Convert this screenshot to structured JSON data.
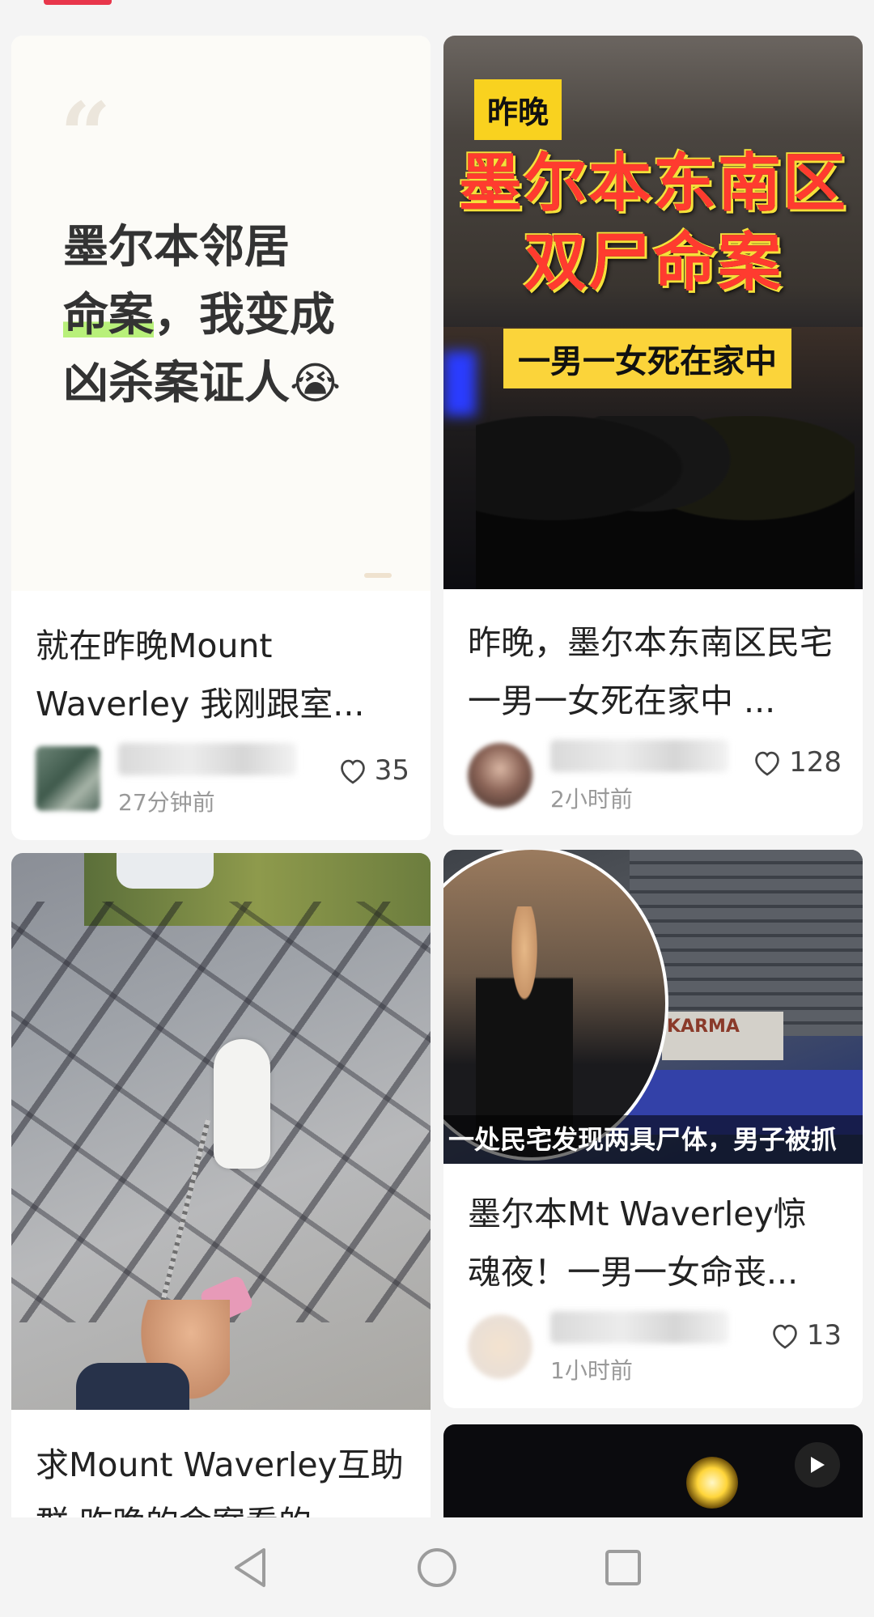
{
  "feed": {
    "cards": [
      {
        "cover_text_lines": [
          "墨尔本邻居",
          "命案",
          "，我变成",
          "凶杀案证人"
        ],
        "cover_emoji": "😭",
        "title": "就在昨晚Mount Waverley 我刚跟室...",
        "author": "Hacitas",
        "time": "27分钟前",
        "likes": "35"
      },
      {
        "cover_badge": "昨晚",
        "cover_headline_1": "墨尔本东南区",
        "cover_headline_2": "双尸命案",
        "cover_sub": "一男一女死在家中",
        "title": "昨晚，墨尔本东南区民宅一男一女死在家中 ...",
        "author": "",
        "time": "2小时前",
        "likes": "128"
      },
      {
        "title": "求Mount Waverley互助群 昨晚的命案看的",
        "cover_desc": "dog-walk-shadow-photo"
      },
      {
        "cover_caption": "一处民宅发现两具尸体，男子被抓",
        "cover_sign": "KARMA",
        "title": "墨尔本Mt Waverley惊魂夜！一男一女命丧...",
        "author": "",
        "time": "1小时前",
        "likes": "13"
      },
      {
        "video_icon": "play-icon"
      }
    ]
  },
  "nav": {
    "back_icon": "back-triangle-icon",
    "home_icon": "home-circle-icon",
    "recents_icon": "recents-square-icon"
  },
  "colors": {
    "accent": "#e8364b",
    "highlight": "#b8f07a",
    "headline_red": "#ff3b2f",
    "badge_yellow": "#f9d21f"
  }
}
